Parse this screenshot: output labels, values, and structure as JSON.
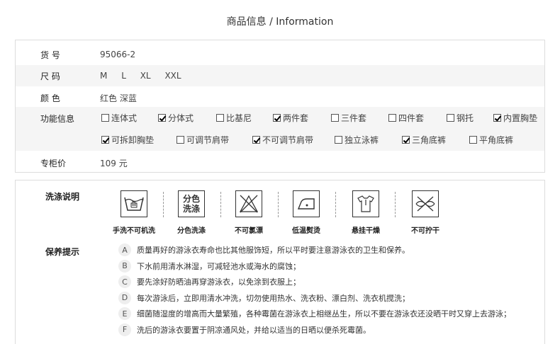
{
  "title": "商品信息 / Information",
  "info": {
    "item_no": {
      "label": "货  号",
      "value": "95066-2"
    },
    "size": {
      "label": "尺  码",
      "values": [
        "M",
        "L",
        "XL",
        "XXL"
      ]
    },
    "color": {
      "label": "颜  色",
      "value": "红色 深蓝"
    },
    "function": {
      "label": "功能信息",
      "options": [
        {
          "text": "连体式",
          "checked": false
        },
        {
          "text": "分体式",
          "checked": true
        },
        {
          "text": "比基尼",
          "checked": false
        },
        {
          "text": "两件套",
          "checked": true
        },
        {
          "text": "三件套",
          "checked": false
        },
        {
          "text": "四件套",
          "checked": false
        },
        {
          "text": "钢托",
          "checked": false
        },
        {
          "text": "内置胸垫",
          "checked": true
        },
        {
          "text": "可拆卸胸垫",
          "checked": true
        },
        {
          "text": "可调节肩带",
          "checked": false
        },
        {
          "text": "不可调节肩带",
          "checked": true
        },
        {
          "text": "独立泳裤",
          "checked": false
        },
        {
          "text": "三角底裤",
          "checked": true
        },
        {
          "text": "平角底裤",
          "checked": false
        }
      ]
    },
    "price": {
      "label": "专柜价",
      "value": "109 元"
    }
  },
  "care": {
    "label": "洗涤说明",
    "icon_text": "分色洗涤",
    "items": [
      {
        "caption": "手洗不可机洗",
        "icon": "hand-wash-icon"
      },
      {
        "caption": "分色洗涤",
        "icon": "separate-wash-icon"
      },
      {
        "caption": "不可氯漂",
        "icon": "no-bleach-icon"
      },
      {
        "caption": "低温熨烫",
        "icon": "low-iron-icon"
      },
      {
        "caption": "悬挂干燥",
        "icon": "hang-dry-icon"
      },
      {
        "caption": "不可拧干",
        "icon": "no-wring-icon"
      }
    ]
  },
  "tips": {
    "label": "保养提示",
    "items": [
      {
        "letter": "A",
        "text": "质量再好的游泳衣寿命也比其他服饰短，所以平时要注意游泳衣的卫生和保养。"
      },
      {
        "letter": "B",
        "text": "下水前用清水淋湿，可减轻池水或海水的腐蚀；"
      },
      {
        "letter": "C",
        "text": "要先涂好防晒油再穿游泳衣，以免涂到衣服上；"
      },
      {
        "letter": "D",
        "text": "每次游泳后，立即用清水冲洗，切勿使用热水、洗衣粉、漂白剂、洗衣机搅洗；"
      },
      {
        "letter": "E",
        "text": "细菌随湿度的增高而大量繁殖，各种霉菌在游泳衣上相继丛生，所以不要在游泳衣还没晒干时又穿上去游泳；"
      },
      {
        "letter": "F",
        "text": "洗后的游泳衣要置于阴凉通风处，并给以适当的日晒以便杀死霉菌。"
      }
    ]
  }
}
